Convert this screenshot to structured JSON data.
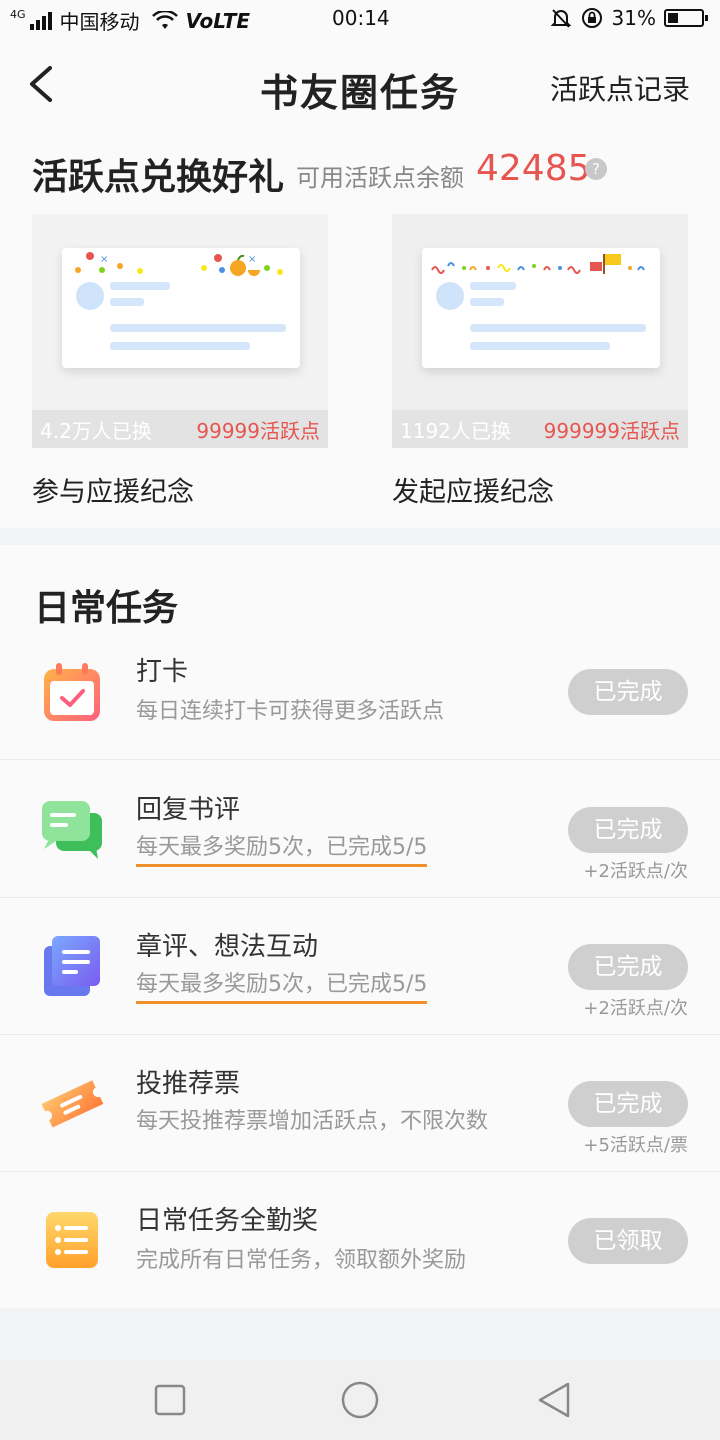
{
  "status_bar": {
    "network_badge": "4G",
    "carrier": "中国移动",
    "volte": "VoLTE",
    "time": "00:14",
    "battery": "31%",
    "battery_level": 0.31
  },
  "header": {
    "title": "书友圈任务",
    "right_link": "活跃点记录"
  },
  "exchange": {
    "title": "活跃点兑换好礼",
    "balance_label": "可用活跃点余额",
    "balance": "42485",
    "help_glyph": "?",
    "items": [
      {
        "name": "参与应援纪念",
        "count": "4.2万人已换",
        "cost": "99999活跃点"
      },
      {
        "name": "发起应援纪念",
        "count": "1192人已换",
        "cost": "999999活跃点"
      }
    ]
  },
  "daily": {
    "title": "日常任务",
    "tasks": [
      {
        "name": "打卡",
        "desc": "每日连续打卡可获得更多活跃点",
        "button": "已完成",
        "reward": "",
        "icon": "calendar-check-icon"
      },
      {
        "name": "回复书评",
        "desc": "每天最多奖励5次，已完成5/5",
        "button": "已完成",
        "reward": "+2活跃点/次",
        "icon": "chat-bubbles-icon"
      },
      {
        "name": "章评、想法互动",
        "desc": "每天最多奖励5次，已完成5/5",
        "button": "已完成",
        "reward": "+2活跃点/次",
        "icon": "document-icon"
      },
      {
        "name": "投推荐票",
        "desc": "每天投推荐票增加活跃点，不限次数",
        "button": "已完成",
        "reward": "+5活跃点/票",
        "icon": "ticket-icon"
      },
      {
        "name": "日常任务全勤奖",
        "desc": "完成所有日常任务，领取额外奖励",
        "button": "已领取",
        "reward": "",
        "icon": "list-icon"
      }
    ]
  },
  "colors": {
    "accent_red": "#e65550",
    "underline_orange": "#f0902a",
    "button_disabled": "#cfcfcf"
  }
}
